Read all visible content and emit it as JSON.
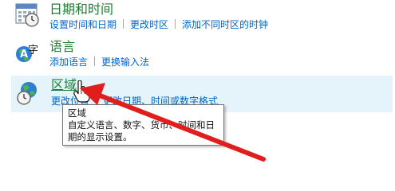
{
  "sections": {
    "datetime": {
      "icon": "calendar-clock-icon",
      "title": "日期和时间",
      "links": [
        "设置时间和日期",
        "更改时区",
        "添加不同时区的时钟"
      ]
    },
    "language": {
      "icon": "language-icon",
      "title": "语言",
      "links": [
        "添加语言",
        "更换输入法"
      ]
    },
    "region": {
      "icon": "globe-clock-icon",
      "title": "区域",
      "links": [
        "更改位置",
        "更改日期、时间或数字格式"
      ]
    }
  },
  "tooltip": {
    "title": "区域",
    "line1": "自定义语言、数字、货币、时间和日",
    "line2": "期的显示设置。"
  },
  "colors": {
    "title": "#1e7e34",
    "link": "#0066cc",
    "highlight": "#e5f3fb",
    "arrow": "#e01e1e"
  }
}
